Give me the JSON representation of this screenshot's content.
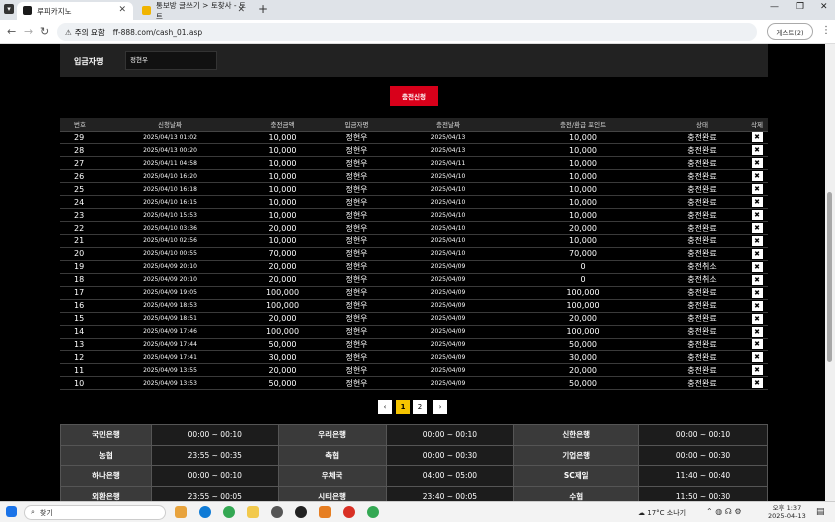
{
  "browser": {
    "tabs": [
      {
        "title": "루피카지노",
        "active": true
      },
      {
        "title": "통보방 글쓰기 > 토찾사 - 토트",
        "active": false
      }
    ],
    "security_label": "주의 요함",
    "url": "ff-888.com/cash_01.asp",
    "guest_label": "게스트(2)"
  },
  "form": {
    "depositor_label": "입금자명",
    "depositor_value": "정현우",
    "submit_label": "충전신청"
  },
  "table": {
    "headers": [
      "번호",
      "신청날짜",
      "충전금액",
      "입금자명",
      "충전날짜",
      "충전/환급 포인트",
      "상태",
      "삭제"
    ],
    "rows": [
      [
        "29",
        "2025/04/13 01:02",
        "10,000",
        "정현우",
        "2025/04/13",
        "10,000",
        "충전완료"
      ],
      [
        "28",
        "2025/04/13 00:20",
        "10,000",
        "정현우",
        "2025/04/13",
        "10,000",
        "충전완료"
      ],
      [
        "27",
        "2025/04/11 04:58",
        "10,000",
        "정현우",
        "2025/04/11",
        "10,000",
        "충전완료"
      ],
      [
        "26",
        "2025/04/10 16:20",
        "10,000",
        "정현우",
        "2025/04/10",
        "10,000",
        "충전완료"
      ],
      [
        "25",
        "2025/04/10 16:18",
        "10,000",
        "정현우",
        "2025/04/10",
        "10,000",
        "충전완료"
      ],
      [
        "24",
        "2025/04/10 16:15",
        "10,000",
        "정현우",
        "2025/04/10",
        "10,000",
        "충전완료"
      ],
      [
        "23",
        "2025/04/10 15:53",
        "10,000",
        "정현우",
        "2025/04/10",
        "10,000",
        "충전완료"
      ],
      [
        "22",
        "2025/04/10 03:36",
        "20,000",
        "정현우",
        "2025/04/10",
        "20,000",
        "충전완료"
      ],
      [
        "21",
        "2025/04/10 02:56",
        "10,000",
        "정현우",
        "2025/04/10",
        "10,000",
        "충전완료"
      ],
      [
        "20",
        "2025/04/10 00:55",
        "70,000",
        "정현우",
        "2025/04/10",
        "70,000",
        "충전완료"
      ],
      [
        "19",
        "2025/04/09 20:10",
        "20,000",
        "정현우",
        "2025/04/09",
        "0",
        "충전취소"
      ],
      [
        "18",
        "2025/04/09 20:10",
        "20,000",
        "정현우",
        "2025/04/09",
        "0",
        "충전취소"
      ],
      [
        "17",
        "2025/04/09 19:05",
        "100,000",
        "정현우",
        "2025/04/09",
        "100,000",
        "충전완료"
      ],
      [
        "16",
        "2025/04/09 18:53",
        "100,000",
        "정현우",
        "2025/04/09",
        "100,000",
        "충전완료"
      ],
      [
        "15",
        "2025/04/09 18:51",
        "20,000",
        "정현우",
        "2025/04/09",
        "20,000",
        "충전완료"
      ],
      [
        "14",
        "2025/04/09 17:46",
        "100,000",
        "정현우",
        "2025/04/09",
        "100,000",
        "충전완료"
      ],
      [
        "13",
        "2025/04/09 17:44",
        "50,000",
        "정현우",
        "2025/04/09",
        "50,000",
        "충전완료"
      ],
      [
        "12",
        "2025/04/09 17:41",
        "30,000",
        "정현우",
        "2025/04/09",
        "30,000",
        "충전완료"
      ],
      [
        "11",
        "2025/04/09 13:55",
        "20,000",
        "정현우",
        "2025/04/09",
        "20,000",
        "충전완료"
      ],
      [
        "10",
        "2025/04/09 13:53",
        "50,000",
        "정현우",
        "2025/04/09",
        "50,000",
        "충전완료"
      ]
    ],
    "delete_glyph": "✖"
  },
  "pagination": {
    "prev": "‹",
    "pages": [
      "1",
      "2"
    ],
    "current": "1",
    "next": "›",
    "current_color": "#f5c400"
  },
  "banks": [
    [
      [
        "국민은행",
        "00:00 ~ 00:10"
      ],
      [
        "우리은행",
        "00:00 ~ 00:10"
      ],
      [
        "신한은행",
        "00:00 ~ 00:10"
      ]
    ],
    [
      [
        "농협",
        "23:55 ~ 00:35"
      ],
      [
        "축협",
        "00:00 ~ 00:30"
      ],
      [
        "기업은행",
        "00:00 ~ 00:30"
      ]
    ],
    [
      [
        "하나은행",
        "00:00 ~ 00:10"
      ],
      [
        "우체국",
        "04:00 ~ 05:00"
      ],
      [
        "SC제일",
        "11:40 ~ 00:40"
      ]
    ],
    [
      [
        "외환은행",
        "23:55 ~ 00:05"
      ],
      [
        "시티은행",
        "23:40 ~ 00:05"
      ],
      [
        "수협",
        "11:50 ~ 00:30"
      ]
    ]
  ],
  "taskbar": {
    "search_label": "찾기",
    "weather": "17°C 소나기",
    "time": "오후 1:37",
    "date": "2025-04-13"
  },
  "colors": {
    "submit": "#d8001a",
    "page_bg": "#000000"
  }
}
